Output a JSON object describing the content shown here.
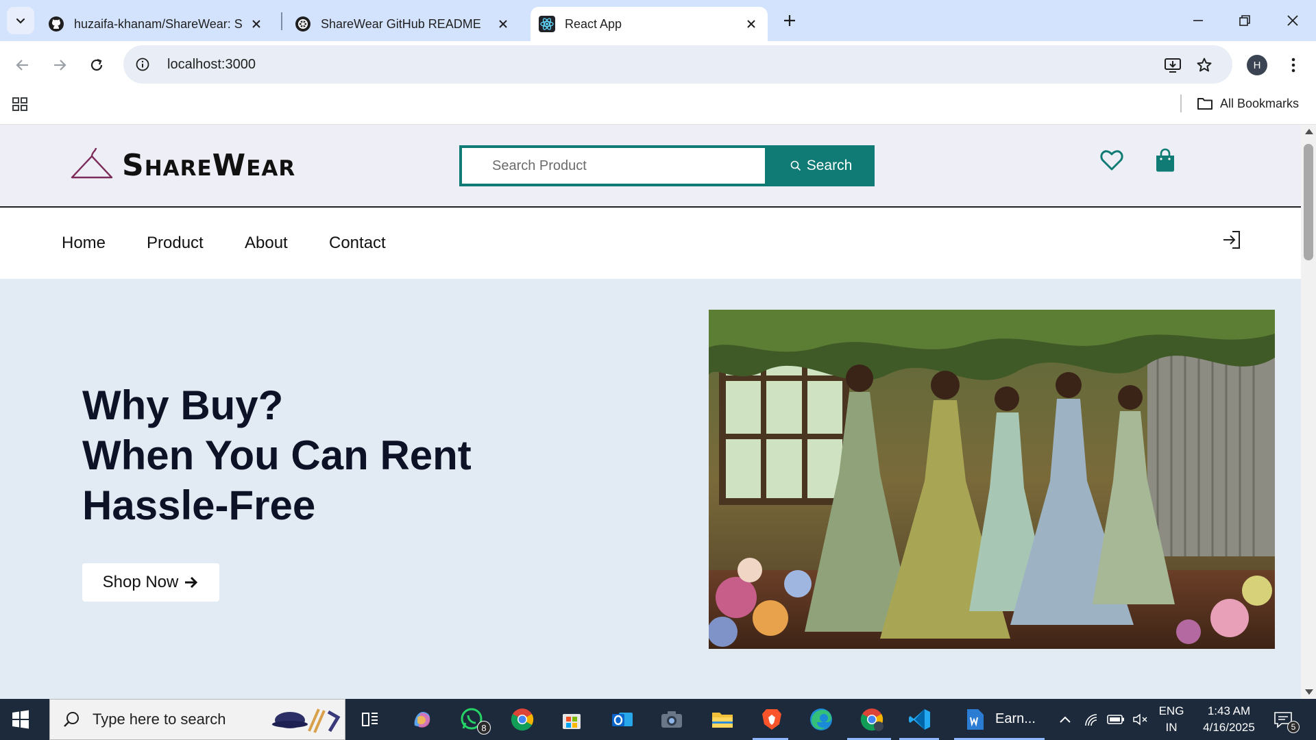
{
  "browser": {
    "tabs": [
      {
        "title": "huzaifa-khanam/ShareWear: Sh",
        "icon": "github-icon",
        "active": false
      },
      {
        "title": "ShareWear GitHub README",
        "icon": "chatgpt-icon",
        "active": false
      },
      {
        "title": "React App",
        "icon": "react-icon",
        "active": true
      }
    ],
    "url": "localhost:3000",
    "profile_initial": "H",
    "bookmarks_label": "All Bookmarks"
  },
  "site": {
    "logo_text": "ShareWear",
    "search": {
      "placeholder": "Search Product",
      "button_label": "Search"
    },
    "nav": [
      "Home",
      "Product",
      "About",
      "Contact"
    ],
    "hero": {
      "title_lines": [
        "Why Buy?",
        "When You Can Rent",
        "Hassle-Free"
      ],
      "cta_label": "Shop Now"
    },
    "colors": {
      "accent": "#0f7b74",
      "header_bg": "#eeeff6",
      "hero_bg": "#e2eaf4"
    }
  },
  "taskbar": {
    "search_placeholder": "Type here to search",
    "whatsapp_badge": "8",
    "word_label": "Earn...",
    "language": "ENG",
    "region": "IN",
    "time": "1:43 AM",
    "date": "4/16/2025",
    "notifications_count": "5"
  }
}
